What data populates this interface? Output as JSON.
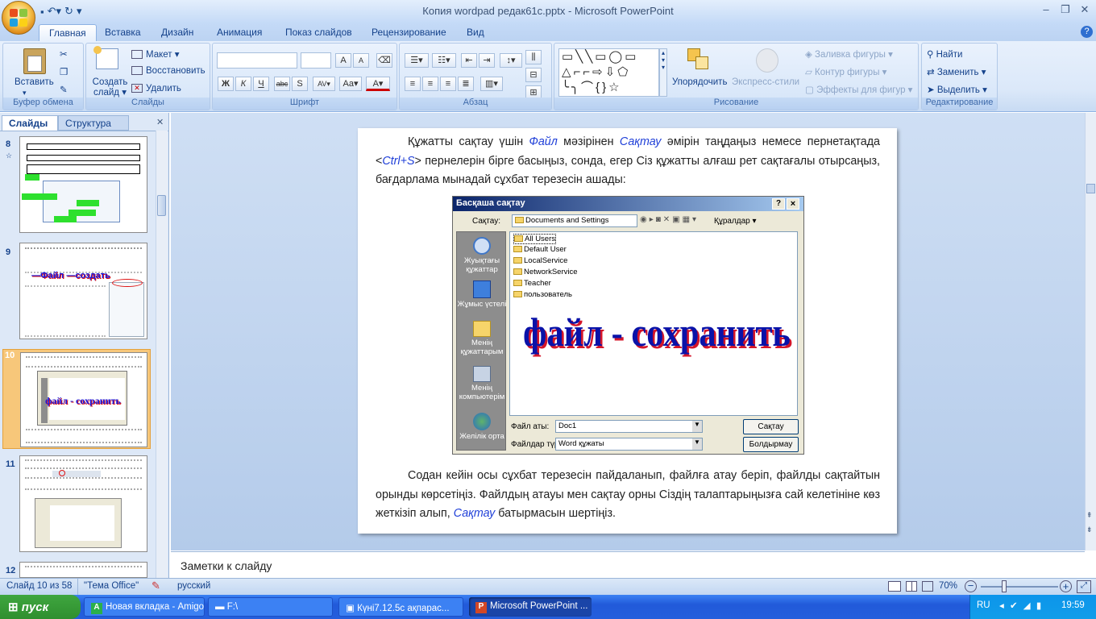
{
  "window": {
    "title": "Копия wordpad редак61с.pptx - Microsoft PowerPoint"
  },
  "tabs": [
    "Главная",
    "Вставка",
    "Дизайн",
    "Анимация",
    "Показ слайдов",
    "Рецензирование",
    "Вид"
  ],
  "ribbon": {
    "clipboard": {
      "paste": "Вставить",
      "label": "Буфер обмена"
    },
    "slides": {
      "new_slide": "Создать слайд ▾",
      "layout": "Макет ▾",
      "reset": "Восстановить",
      "delete": "Удалить",
      "label": "Слайды"
    },
    "font": {
      "label": "Шрифт"
    },
    "paragraph": {
      "label": "Абзац"
    },
    "drawing": {
      "arrange": "Упорядочить",
      "quick_styles": "Экспресс-стили",
      "fill": "Заливка фигуры ▾",
      "outline": "Контур фигуры ▾",
      "effects": "Эффекты для фигур ▾",
      "label": "Рисование"
    },
    "editing": {
      "find": "Найти",
      "replace": "Заменить ▾",
      "select": "Выделить ▾",
      "label": "Редактирование"
    }
  },
  "left_pane": {
    "tabs": [
      "Слайды",
      "Структура"
    ],
    "slides": [
      {
        "num": "8"
      },
      {
        "num": "9"
      },
      {
        "num": "10",
        "big": "файл - сохранить"
      },
      {
        "num": "11"
      },
      {
        "num": "12"
      }
    ]
  },
  "slide": {
    "para1_a": "Құжатты сақтау үшін ",
    "para1_file": "Файл",
    "para1_b": " мәзірінен ",
    "para1_save": "Сақтау",
    "para1_c": " әмірін таңдаңыз немесе пернетақтада <",
    "para1_keys": "Ctrl+S",
    "para1_d": "> пернелерін бірге басыңыз, сонда, егер Сіз құжатты алғаш рет сақтағалы отырсаңыз, бағдарлама мынадай сұхбат терезесін ашады:",
    "para2_a": "Содан кейін осы сұхбат терезесін пайдаланып, файлға атау беріп, файлды сақтайтын орынды көрсетіңіз. Файлдың атауы мен сақтау орны Сіздің талаптарыңызға сай келетініне көз жеткізіп алып, ",
    "para2_save": "Сақтау",
    "para2_b": " батырмасын шертіңіз."
  },
  "dialog": {
    "title": "Басқаша сақтау",
    "help": "?",
    "close": "×",
    "save_in_label": "Сақтау:",
    "save_in_value": "Documents and Settings",
    "tools": "Құралдар ▾",
    "places": [
      "Жуықтағы құжаттар",
      "Жұмыс үстелі",
      "Менің құжаттарым",
      "Менің компьютерім",
      "Желілік орта"
    ],
    "files": [
      "All Users",
      "Default User",
      "LocalService",
      "NetworkService",
      "Teacher",
      "пользователь"
    ],
    "big_text": "файл - сохранить",
    "filename_label": "Файл аты:",
    "filename_value": "Doc1",
    "type_label": "Файлдар түрі:",
    "type_value": "Word құжаты",
    "save_btn": "Сақтау",
    "cancel_btn": "Болдырмау"
  },
  "notes": {
    "placeholder": "Заметки к слайду"
  },
  "status": {
    "slide": "Слайд 10 из 58",
    "theme": "\"Тема Office\"",
    "lang": "русский",
    "zoom": "70%"
  },
  "taskbar": {
    "start": "пуск",
    "tasks": [
      "Новая вкладка - Amigo",
      "F:\\",
      "Күні7.12.5с ақпарас...",
      "Microsoft PowerPoint ..."
    ],
    "lang": "RU",
    "time": "19:59"
  },
  "colors": {
    "accent": "#15428b",
    "slide_em": "#1f3fd8",
    "big_text": "#0a12a8",
    "big_shadow": "#d4152a"
  }
}
